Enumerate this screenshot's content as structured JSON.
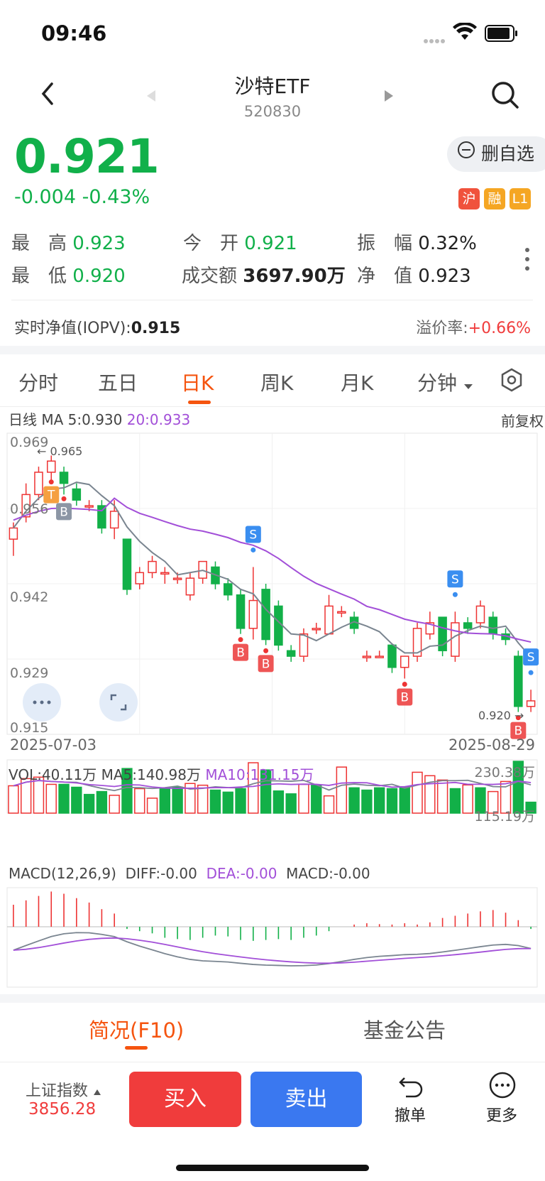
{
  "status_bar": {
    "time": "09:46"
  },
  "header": {
    "title": "沙特ETF",
    "code": "520830"
  },
  "quote": {
    "price": "0.921",
    "change": "-0.004",
    "change_pct": "-0.43%",
    "watch_button": "删自选",
    "tags": [
      {
        "label": "沪",
        "color": "#f0523c"
      },
      {
        "label": "融",
        "color": "#f5a623"
      },
      {
        "label": "L1",
        "color": "#f5a623"
      }
    ]
  },
  "stats": {
    "high_label": "最　高",
    "high": "0.923",
    "open_label": "今　开",
    "open": "0.921",
    "amp_label": "振　幅",
    "amp": "0.32%",
    "low_label": "最　低",
    "low": "0.920",
    "turnover_label": "成交额",
    "turnover": "3697.90万",
    "nav_label": "净　值",
    "nav": "0.923",
    "iopv_label": "实时净值(IOPV):",
    "iopv": "0.915",
    "premium_label": "溢价率:",
    "premium": "+0.66%"
  },
  "tabs": [
    "分时",
    "五日",
    "日K",
    "周K",
    "月K",
    "分钟"
  ],
  "active_tab": 2,
  "chart": {
    "ma_line": "日线 MA 5:0.930",
    "ma20": "20:0.933",
    "adj_label": "前复权",
    "y_labels": [
      "0.969",
      "0.956",
      "0.942",
      "0.929",
      "0.915"
    ],
    "high_marker": "0.965",
    "low_marker": "0.920",
    "start_date": "2025-07-03",
    "end_date": "2025-08-29",
    "vol_label": "VOL:40.11万",
    "vol_ma5": "MA5:140.98万",
    "vol_ma10": "MA10:131.15万",
    "vol_max": "230.38万",
    "vol_mid": "115.19万",
    "macd_title": "MACD(12,26,9)",
    "diff": "DIFF:-0.00",
    "dea": "DEA:-0.00",
    "macd": "MACD:-0.00"
  },
  "chart_data": {
    "type": "candlestick",
    "ylim": [
      0.915,
      0.969
    ],
    "series": [
      {
        "name": "K",
        "values": [
          [
            0.95,
            0.952,
            0.947,
            0.953
          ],
          [
            0.954,
            0.958,
            0.953,
            0.96
          ],
          [
            0.958,
            0.962,
            0.957,
            0.963
          ],
          [
            0.962,
            0.964,
            0.96,
            0.965
          ],
          [
            0.962,
            0.96,
            0.958,
            0.963
          ],
          [
            0.959,
            0.957,
            0.956,
            0.96
          ],
          [
            0.956,
            0.956,
            0.955,
            0.957
          ],
          [
            0.956,
            0.952,
            0.951,
            0.957
          ],
          [
            0.952,
            0.955,
            0.95,
            0.957
          ],
          [
            0.95,
            0.941,
            0.94,
            0.95
          ],
          [
            0.942,
            0.944,
            0.941,
            0.945
          ],
          [
            0.944,
            0.946,
            0.943,
            0.947
          ],
          [
            0.944,
            0.944,
            0.942,
            0.945
          ],
          [
            0.943,
            0.943,
            0.942,
            0.944
          ],
          [
            0.94,
            0.943,
            0.939,
            0.944
          ],
          [
            0.943,
            0.946,
            0.942,
            0.946
          ],
          [
            0.945,
            0.942,
            0.941,
            0.946
          ],
          [
            0.942,
            0.94,
            0.939,
            0.943
          ],
          [
            0.94,
            0.934,
            0.933,
            0.941
          ],
          [
            0.934,
            0.939,
            0.932,
            0.945
          ],
          [
            0.941,
            0.932,
            0.931,
            0.942
          ],
          [
            0.938,
            0.931,
            0.93,
            0.939
          ],
          [
            0.93,
            0.929,
            0.928,
            0.931
          ],
          [
            0.929,
            0.933,
            0.928,
            0.934
          ],
          [
            0.934,
            0.934,
            0.933,
            0.935
          ],
          [
            0.933,
            0.938,
            0.933,
            0.94
          ],
          [
            0.937,
            0.937,
            0.936,
            0.938
          ],
          [
            0.936,
            0.934,
            0.933,
            0.937
          ],
          [
            0.929,
            0.929,
            0.928,
            0.93
          ],
          [
            0.929,
            0.929,
            0.929,
            0.93
          ],
          [
            0.931,
            0.927,
            0.926,
            0.931
          ],
          [
            0.927,
            0.929,
            0.925,
            0.929
          ],
          [
            0.929,
            0.934,
            0.928,
            0.935
          ],
          [
            0.933,
            0.935,
            0.932,
            0.937
          ],
          [
            0.936,
            0.93,
            0.929,
            0.936
          ],
          [
            0.929,
            0.935,
            0.928,
            0.937
          ],
          [
            0.935,
            0.934,
            0.933,
            0.936
          ],
          [
            0.935,
            0.938,
            0.934,
            0.939
          ],
          [
            0.936,
            0.933,
            0.932,
            0.937
          ],
          [
            0.933,
            0.932,
            0.931,
            0.934
          ],
          [
            0.929,
            0.92,
            0.919,
            0.93
          ],
          [
            0.92,
            0.921,
            0.919,
            0.923
          ]
        ]
      }
    ],
    "x_start": "2025-07-03",
    "x_end": "2025-08-29",
    "volume": [
      95,
      120,
      125,
      100,
      100,
      90,
      65,
      75,
      62,
      155,
      85,
      52,
      88,
      90,
      103,
      97,
      80,
      73,
      85,
      175,
      150,
      77,
      67,
      100,
      97,
      60,
      160,
      88,
      80,
      88,
      85,
      92,
      142,
      130,
      115,
      85,
      98,
      88,
      75,
      110,
      180,
      38
    ],
    "volume_colors": [
      "r",
      "r",
      "r",
      "r",
      "g",
      "g",
      "g",
      "g",
      "r",
      "g",
      "r",
      "r",
      "g",
      "g",
      "r",
      "r",
      "g",
      "g",
      "g",
      "r",
      "g",
      "g",
      "g",
      "r",
      "g",
      "r",
      "r",
      "g",
      "g",
      "g",
      "g",
      "g",
      "r",
      "r",
      "r",
      "g",
      "r",
      "g",
      "r",
      "r",
      "g",
      "g"
    ],
    "macd_hist": [
      0.5,
      0.6,
      0.7,
      0.8,
      0.75,
      0.65,
      0.55,
      0.4,
      0.3,
      -0.05,
      -0.1,
      -0.15,
      -0.25,
      -0.28,
      -0.3,
      -0.25,
      -0.2,
      -0.22,
      -0.3,
      -0.32,
      -0.3,
      -0.28,
      -0.3,
      -0.25,
      -0.2,
      -0.1,
      0,
      0.05,
      0.08,
      0.06,
      0.05,
      0.08,
      0.05,
      0.1,
      0.2,
      0.25,
      0.3,
      0.35,
      0.38,
      0.32,
      0.15,
      -0.05
    ],
    "signals": [
      {
        "label": "T",
        "index": 3,
        "type": "buy"
      },
      {
        "label": "B",
        "index": 4,
        "type": "neutral"
      },
      {
        "label": "S",
        "index": 19,
        "type": "sell"
      },
      {
        "label": "B",
        "index": 18,
        "type": "buy"
      },
      {
        "label": "B",
        "index": 20,
        "type": "buy"
      },
      {
        "label": "B",
        "index": 31,
        "type": "buy"
      },
      {
        "label": "S",
        "index": 35,
        "type": "sell"
      },
      {
        "label": "S",
        "index": 41,
        "type": "sell"
      },
      {
        "label": "B",
        "index": 40,
        "type": "buy"
      }
    ]
  },
  "bottom_tabs": {
    "tab1": "简况(F10)",
    "tab2": "基金公告"
  },
  "bottom_bar": {
    "index_name": "上证指数",
    "index_value": "3856.28",
    "buy": "买入",
    "sell": "卖出",
    "undo": "撤单",
    "more": "更多"
  }
}
